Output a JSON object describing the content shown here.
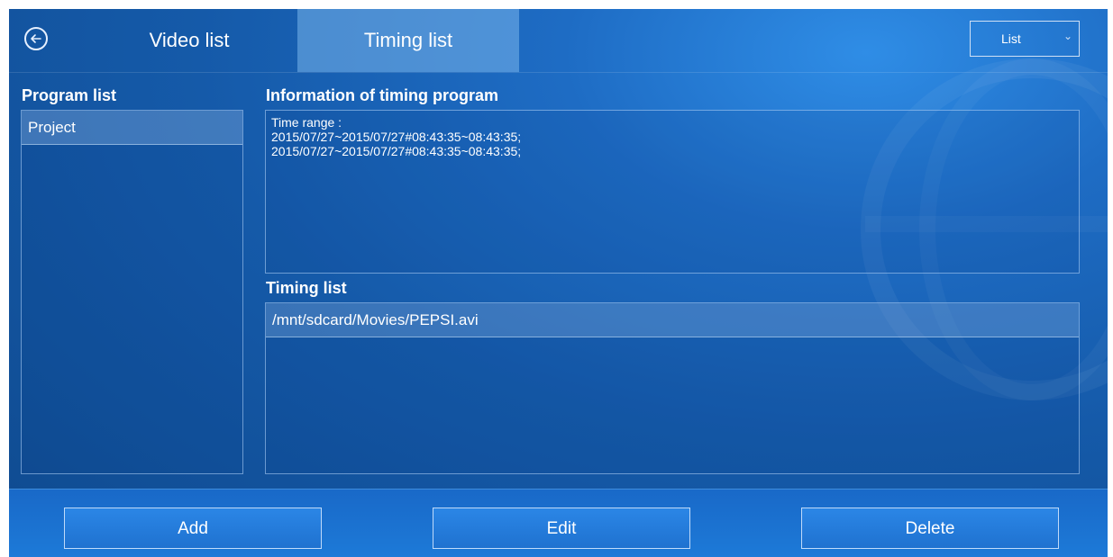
{
  "header": {
    "back_icon": "back-arrow-circle-icon",
    "tabs": [
      {
        "label": "Video list",
        "active": false
      },
      {
        "label": "Timing list",
        "active": true
      }
    ],
    "view_select": {
      "value": "List",
      "arrow_icon": "chevron-down-icon"
    }
  },
  "program_list": {
    "title": "Program list",
    "items": [
      "Project"
    ]
  },
  "info": {
    "title": "Information of timing program",
    "text": "Time range :\n2015/07/27~2015/07/27#08:43:35~08:43:35;\n2015/07/27~2015/07/27#08:43:35~08:43:35;"
  },
  "timing_list": {
    "title": "Timing list",
    "items": [
      "/mnt/sdcard/Movies/PEPSI.avi"
    ]
  },
  "footer": {
    "add_label": "Add",
    "edit_label": "Edit",
    "delete_label": "Delete"
  },
  "colors": {
    "background": "#155aa9",
    "active_tab": "#6fa8e0",
    "button": "#2379d8"
  }
}
